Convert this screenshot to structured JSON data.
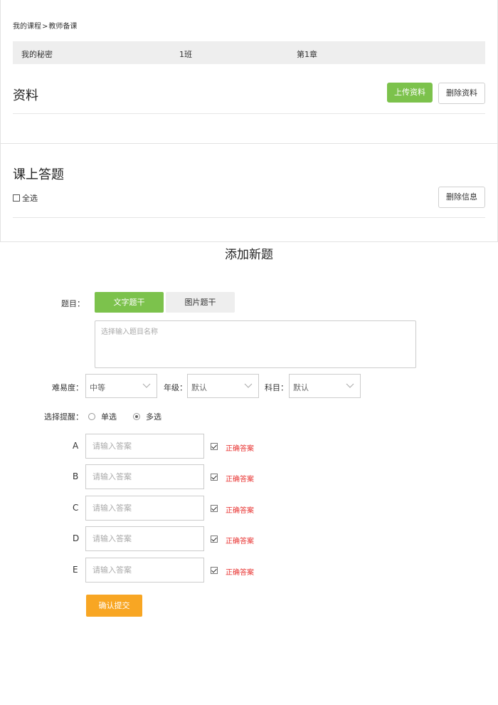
{
  "breadcrumb": {
    "my_courses": "我的课程",
    "separator": ">",
    "teacher_prep": "教师备课"
  },
  "course_bar": {
    "name": "我的秘密",
    "class": "1班",
    "chapter": "第1章"
  },
  "materials": {
    "title": "资料",
    "upload_label": "上传资料",
    "delete_label": "删除资料"
  },
  "class_answers": {
    "title": "课上答题",
    "select_all_label": "全选",
    "delete_info_label": "删除信息"
  },
  "new_question_form": {
    "title": "添加新题",
    "question_label": "题目：",
    "tabs": [
      {
        "label": "文字题干",
        "active": true
      },
      {
        "label": "图片题干",
        "active": false
      }
    ],
    "question_placeholder": "选择输入题目名称",
    "difficulty_label": "难易度：",
    "difficulty_value": "中等",
    "grade_label": "年级：",
    "grade_value": "默认",
    "subject_label": "科目：",
    "subject_value": "默认",
    "choice_label": "选择提醒：",
    "choice_options": [
      {
        "label": "单选",
        "checked": false
      },
      {
        "label": "多选",
        "checked": true
      }
    ],
    "answers": [
      {
        "letter": "A",
        "placeholder": "请输入答案",
        "correct_label": "正确答案",
        "checked": true
      },
      {
        "letter": "B",
        "placeholder": "请输入答案",
        "correct_label": "正确答案",
        "checked": true
      },
      {
        "letter": "C",
        "placeholder": "请输入答案",
        "correct_label": "正确答案",
        "checked": true
      },
      {
        "letter": "D",
        "placeholder": "请输入答案",
        "correct_label": "正确答案",
        "checked": true
      },
      {
        "letter": "E",
        "placeholder": "请输入答案",
        "correct_label": "正确答案",
        "checked": true
      }
    ],
    "submit_label": "确认提交"
  },
  "colors": {
    "green": "#7cc24c",
    "orange": "#f8a623",
    "red": "#e8312f",
    "bar_gray": "#eeeeee"
  }
}
